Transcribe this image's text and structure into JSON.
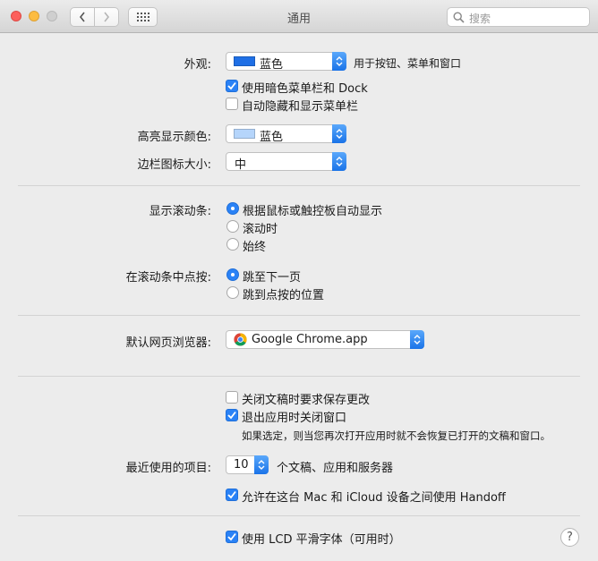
{
  "window": {
    "title": "通用"
  },
  "search": {
    "placeholder": "搜索"
  },
  "appearance": {
    "label": "外观:",
    "value": "蓝色",
    "swatch_color": "#1f6fe5",
    "note": "用于按钮、菜单和窗口",
    "dark_menu": {
      "label": "使用暗色菜单栏和 Dock",
      "checked": true
    },
    "autohide_menu": {
      "label": "自动隐藏和显示菜单栏",
      "checked": false
    }
  },
  "highlight": {
    "label": "高亮显示颜色:",
    "value": "蓝色",
    "swatch_color": "#b5d5fb"
  },
  "sidebar_icon": {
    "label": "边栏图标大小:",
    "value": "中"
  },
  "scrollbars": {
    "label": "显示滚动条:",
    "options": [
      "根据鼠标或触控板自动显示",
      "滚动时",
      "始终"
    ],
    "selected": 0
  },
  "click_scroll": {
    "label": "在滚动条中点按:",
    "options": [
      "跳至下一页",
      "跳到点按的位置"
    ],
    "selected": 0
  },
  "browser": {
    "label": "默认网页浏览器:",
    "value": "Google Chrome.app"
  },
  "documents": {
    "ask_save": {
      "label": "关闭文稿时要求保存更改",
      "checked": false
    },
    "close_windows": {
      "label": "退出应用时关闭窗口",
      "checked": true
    },
    "note": "如果选定，则当您再次打开应用时就不会恢复已打开的文稿和窗口。"
  },
  "recent": {
    "label": "最近使用的项目:",
    "value": "10",
    "suffix": "个文稿、应用和服务器"
  },
  "handoff": {
    "label": "允许在这台 Mac 和 iCloud 设备之间使用 Handoff",
    "checked": true
  },
  "lcd": {
    "label": "使用 LCD 平滑字体（可用时）",
    "checked": true
  },
  "help": {
    "glyph": "?"
  }
}
